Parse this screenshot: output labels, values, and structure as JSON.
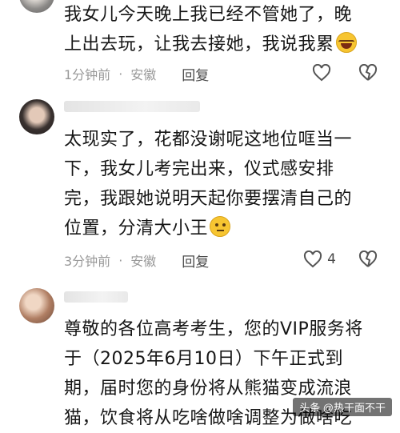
{
  "comments": [
    {
      "lines": [
        "我女儿今天晚上我已经不管她了，晚",
        "上出去玩，让我去接她，我说我累"
      ],
      "emoji": "laughing-emoji",
      "time": "1分钟前",
      "location": "安徽",
      "reply_label": "回复",
      "like_count": ""
    },
    {
      "lines": [
        "太现实了，花都没谢呢这地位哐当一",
        "下，我女儿考完出来，仪式感安排",
        "完，我跟她说明天起你要摆清自己的",
        "位置，分清大小王"
      ],
      "emoji": "thinking-emoji",
      "time": "3分钟前",
      "location": "安徽",
      "reply_label": "回复",
      "like_count": "4"
    },
    {
      "lines": [
        "尊敬的各位高考考生，您的VIP服务将",
        "于（2025年6月10日）下午正式到",
        "期，届时您的身份将从熊猫变成流浪",
        "猫，饮食将从吃啥做啥调整为做啥吃"
      ]
    }
  ],
  "watermark": "头条 @热干面不干",
  "colors": {
    "meta": "#999999",
    "text": "#161616",
    "icon": "#555555"
  }
}
